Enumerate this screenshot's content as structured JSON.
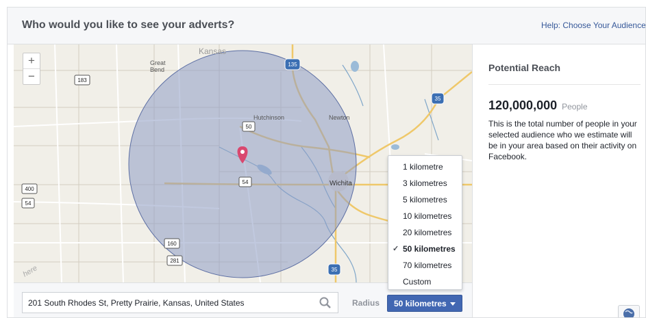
{
  "header": {
    "title": "Who would you like to see your adverts?",
    "help_link": "Help: Choose Your Audience"
  },
  "map": {
    "zoom_in": "+",
    "zoom_out": "−",
    "labels": {
      "kansas": "Kansas",
      "great_bend": "Great\nBend",
      "hutchinson": "Hutchinson",
      "newton": "Newton",
      "wichita": "Wichita",
      "provider": "here"
    },
    "shields": {
      "i135": "135",
      "us183": "183",
      "i35_north": "35",
      "us50": "50",
      "k54_center": "54",
      "us400": "400",
      "k54_west": "54",
      "us160": "160",
      "us281": "281",
      "i35_south": "35"
    },
    "icons": {
      "pin": "location-pin-icon",
      "zoom_in": "plus-icon",
      "zoom_out": "minus-icon"
    }
  },
  "reach": {
    "title": "Potential Reach",
    "number": "120,000,000",
    "unit": "People",
    "description": "This is the total number of people in your selected audience who we estimate will be in your area based on their activity on Facebook."
  },
  "location": {
    "value": "201 South Rhodes St, Pretty Prairie, Kansas, United States"
  },
  "radius": {
    "label": "Radius",
    "selected": "50 kilometres",
    "options": [
      {
        "label": "1 kilometre",
        "selected": false
      },
      {
        "label": "3 kilometres",
        "selected": false
      },
      {
        "label": "5 kilometres",
        "selected": false
      },
      {
        "label": "10 kilometres",
        "selected": false
      },
      {
        "label": "20 kilometres",
        "selected": false
      },
      {
        "label": "50 kilometres",
        "selected": true
      },
      {
        "label": "70 kilometres",
        "selected": false
      },
      {
        "label": "Custom",
        "selected": false
      }
    ]
  },
  "colors": {
    "accent": "#4267b2",
    "circle_fill": "#8e9cc4",
    "pin": "#d9486f",
    "highway_yellow": "#f2d56b"
  }
}
